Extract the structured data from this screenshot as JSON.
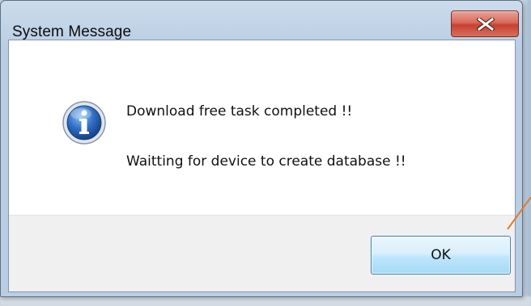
{
  "dialog": {
    "title": "System Message",
    "close_icon": "close-x-icon"
  },
  "message": {
    "icon": "info-icon",
    "line1": "Download free task completed !!",
    "line2": "Waitting for device to create database !!"
  },
  "buttons": {
    "ok_label": "OK"
  },
  "colors": {
    "close_button": "#c7402f",
    "ok_button_border": "#3c7fb1",
    "info_icon": "#2f6fc4",
    "annotation_line": "#e07b2a"
  }
}
